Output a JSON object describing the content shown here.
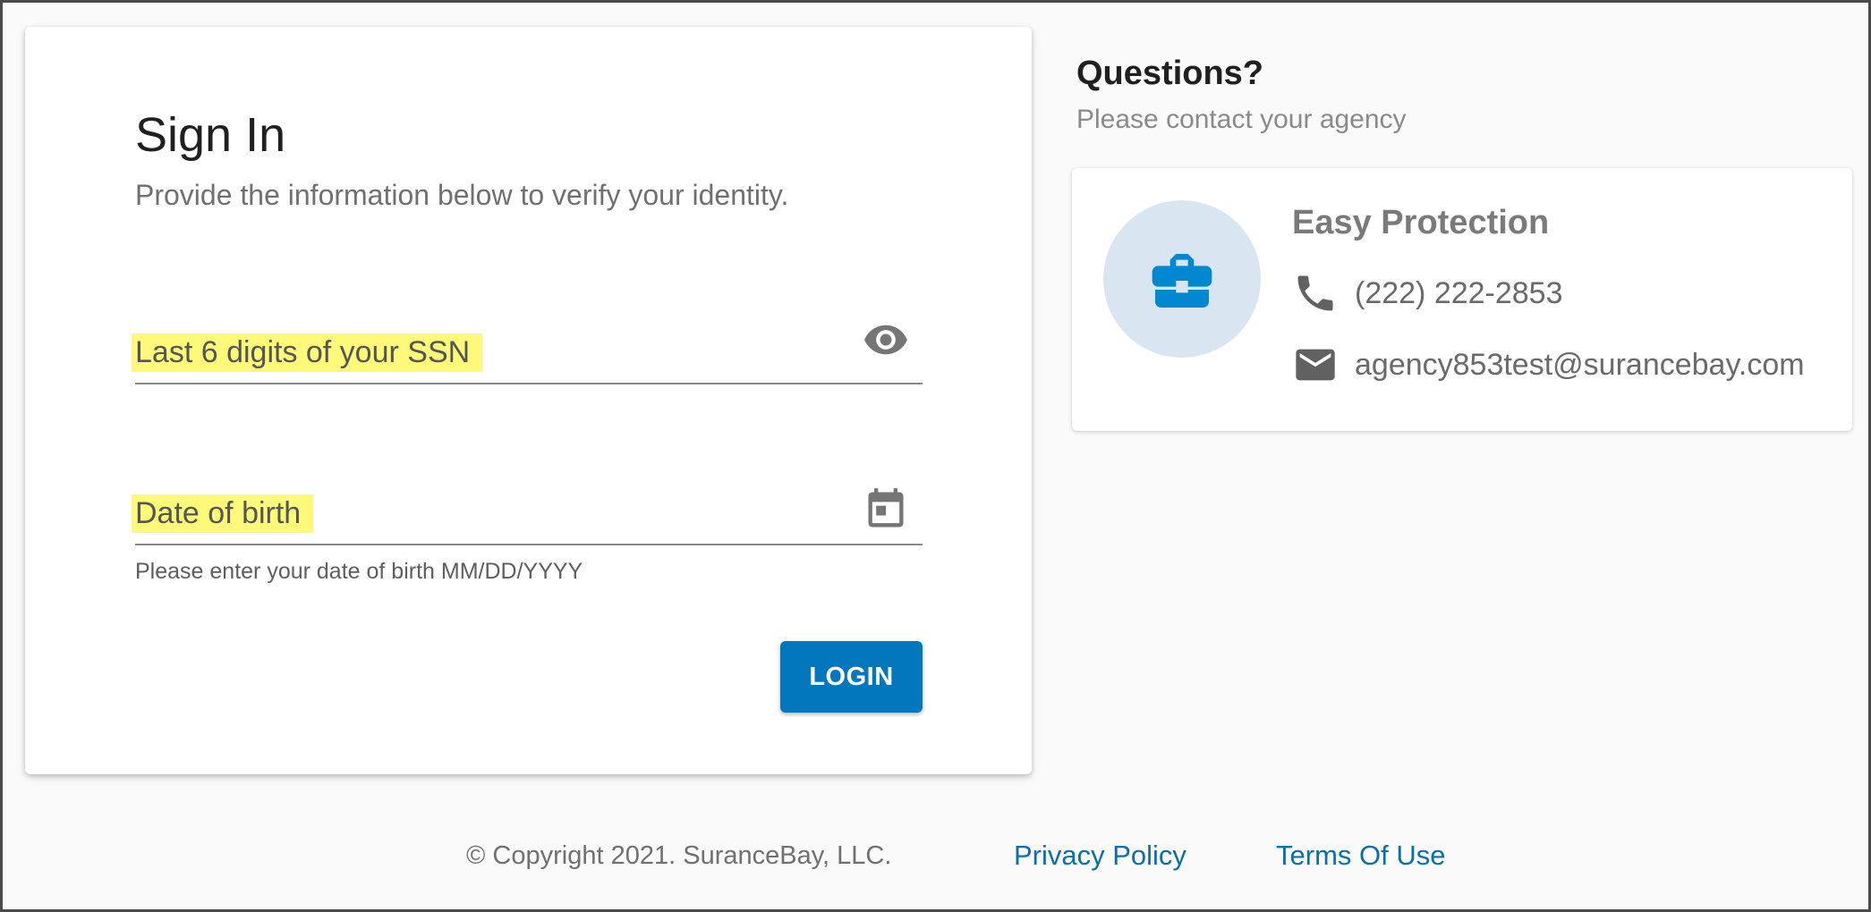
{
  "signin": {
    "title": "Sign In",
    "subtitle": "Provide the information below to verify your identity.",
    "ssn_field": {
      "label": "Last 6 digits of your SSN",
      "icon": "eye-icon"
    },
    "dob_field": {
      "label": "Date of birth",
      "icon": "calendar-icon",
      "helper": "Please enter your date of birth MM/DD/YYYY"
    },
    "login_label": "LOGIN"
  },
  "questions": {
    "title": "Questions?",
    "subtitle": "Please contact your agency"
  },
  "agency": {
    "name": "Easy Protection",
    "phone": "(222) 222-2853",
    "email": "agency853test@surancebay.com",
    "icon": "briefcase-icon"
  },
  "footer": {
    "copyright": "© Copyright 2021. SuranceBay, LLC.",
    "privacy_label": "Privacy Policy",
    "terms_label": "Terms Of Use"
  },
  "colors": {
    "accent": "#0277bd",
    "highlight": "#fff97a",
    "avatar_bg": "#d9e6f2",
    "link": "#0b6fa8"
  }
}
